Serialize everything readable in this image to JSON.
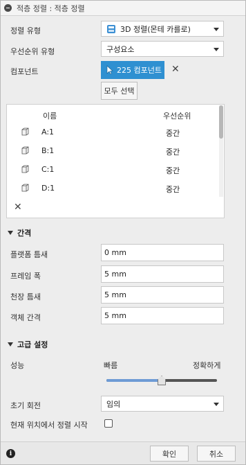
{
  "title": "적층 정렬 : 적층 정렬",
  "fields": {
    "arrange_type": {
      "label": "정렬 유형",
      "value": "3D 정렬(몬테 카를로)"
    },
    "priority_type": {
      "label": "우선순위 유형",
      "value": "구성요소"
    },
    "components": {
      "label": "컴포넌트",
      "selection_label": "225 컴포넌트"
    }
  },
  "select_all_label": "모두 선택",
  "table": {
    "headers": [
      "이름",
      "우선순위"
    ],
    "rows": [
      {
        "name": "A:1",
        "priority": "중간"
      },
      {
        "name": "B:1",
        "priority": "중간"
      },
      {
        "name": "C:1",
        "priority": "중간"
      },
      {
        "name": "D:1",
        "priority": "중간"
      }
    ]
  },
  "spacing_section": {
    "title": "간격",
    "fields": [
      {
        "label": "플랫폼 틈새",
        "value": "0 mm"
      },
      {
        "label": "프레임 폭",
        "value": "5 mm"
      },
      {
        "label": "천장 틈새",
        "value": "5 mm"
      },
      {
        "label": "객체 간격",
        "value": "5 mm"
      }
    ]
  },
  "advanced_section": {
    "title": "고급 설정",
    "performance": {
      "label": "성능",
      "left_label": "빠름",
      "right_label": "정확하게",
      "level": 0.5
    },
    "initial_rotation": {
      "label": "초기 회전",
      "value": "임의"
    },
    "start_from_current": {
      "label": "현재 위치에서 정렬 시작",
      "checked": false
    }
  },
  "footer": {
    "ok_label": "확인",
    "cancel_label": "취소"
  },
  "colors": {
    "accent": "#2f90d1",
    "slider_fill": "#6e9bd5"
  }
}
